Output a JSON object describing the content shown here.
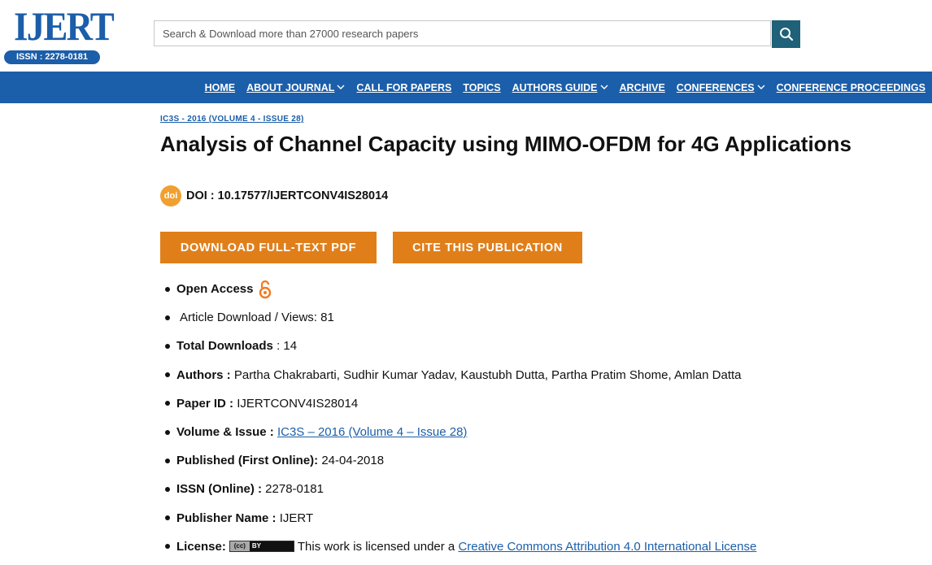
{
  "logo": {
    "text": "IJERT",
    "issn": "ISSN : 2278-0181"
  },
  "search": {
    "placeholder": "Search & Download more than 27000 research papers"
  },
  "nav": [
    {
      "label": "HOME",
      "dropdown": false
    },
    {
      "label": "ABOUT JOURNAL",
      "dropdown": true
    },
    {
      "label": "CALL FOR PAPERS",
      "dropdown": false
    },
    {
      "label": "TOPICS",
      "dropdown": false
    },
    {
      "label": "AUTHORS GUIDE",
      "dropdown": true
    },
    {
      "label": "ARCHIVE",
      "dropdown": false
    },
    {
      "label": "CONFERENCES",
      "dropdown": true
    },
    {
      "label": "CONFERENCE PROCEEDINGS",
      "dropdown": false
    }
  ],
  "article": {
    "issue_link": "IC3S - 2016 (VOLUME 4 - ISSUE 28)",
    "title": "Analysis of Channel Capacity using MIMO-OFDM for 4G Applications",
    "doi_icon": "doi",
    "doi": "DOI : 10.17577/IJERTCONV4IS28014",
    "download_button": "DOWNLOAD FULL-TEXT PDF",
    "cite_button": "CITE THIS PUBLICATION"
  },
  "meta": {
    "open_access": "Open Access",
    "views_label": "Article Download / Views:",
    "views_value": "81",
    "downloads_label": "Total Downloads",
    "downloads_value": ": 14",
    "authors_label": "Authors :",
    "authors_value": "Partha Chakrabarti, Sudhir Kumar Yadav, Kaustubh Dutta, Partha Pratim Shome, Amlan Datta",
    "paper_id_label": "Paper ID :",
    "paper_id_value": "IJERTCONV4IS28014",
    "volume_label": "Volume & Issue :",
    "volume_value": "IC3S – 2016 (Volume 4 – Issue 28)",
    "published_label": "Published (First Online):",
    "published_value": "24-04-2018",
    "issn_label": "ISSN (Online) :",
    "issn_value": "2278-0181",
    "publisher_label": "Publisher Name :",
    "publisher_value": "IJERT",
    "license_label": "License:",
    "cc_left": "(cc)",
    "cc_right": "BY",
    "license_text": "This work is licensed under a",
    "license_link": "Creative Commons Attribution 4.0 International License"
  },
  "colors": {
    "brand": "#1b5ea9",
    "button": "#e07f1a",
    "search_button": "#1e6178"
  }
}
